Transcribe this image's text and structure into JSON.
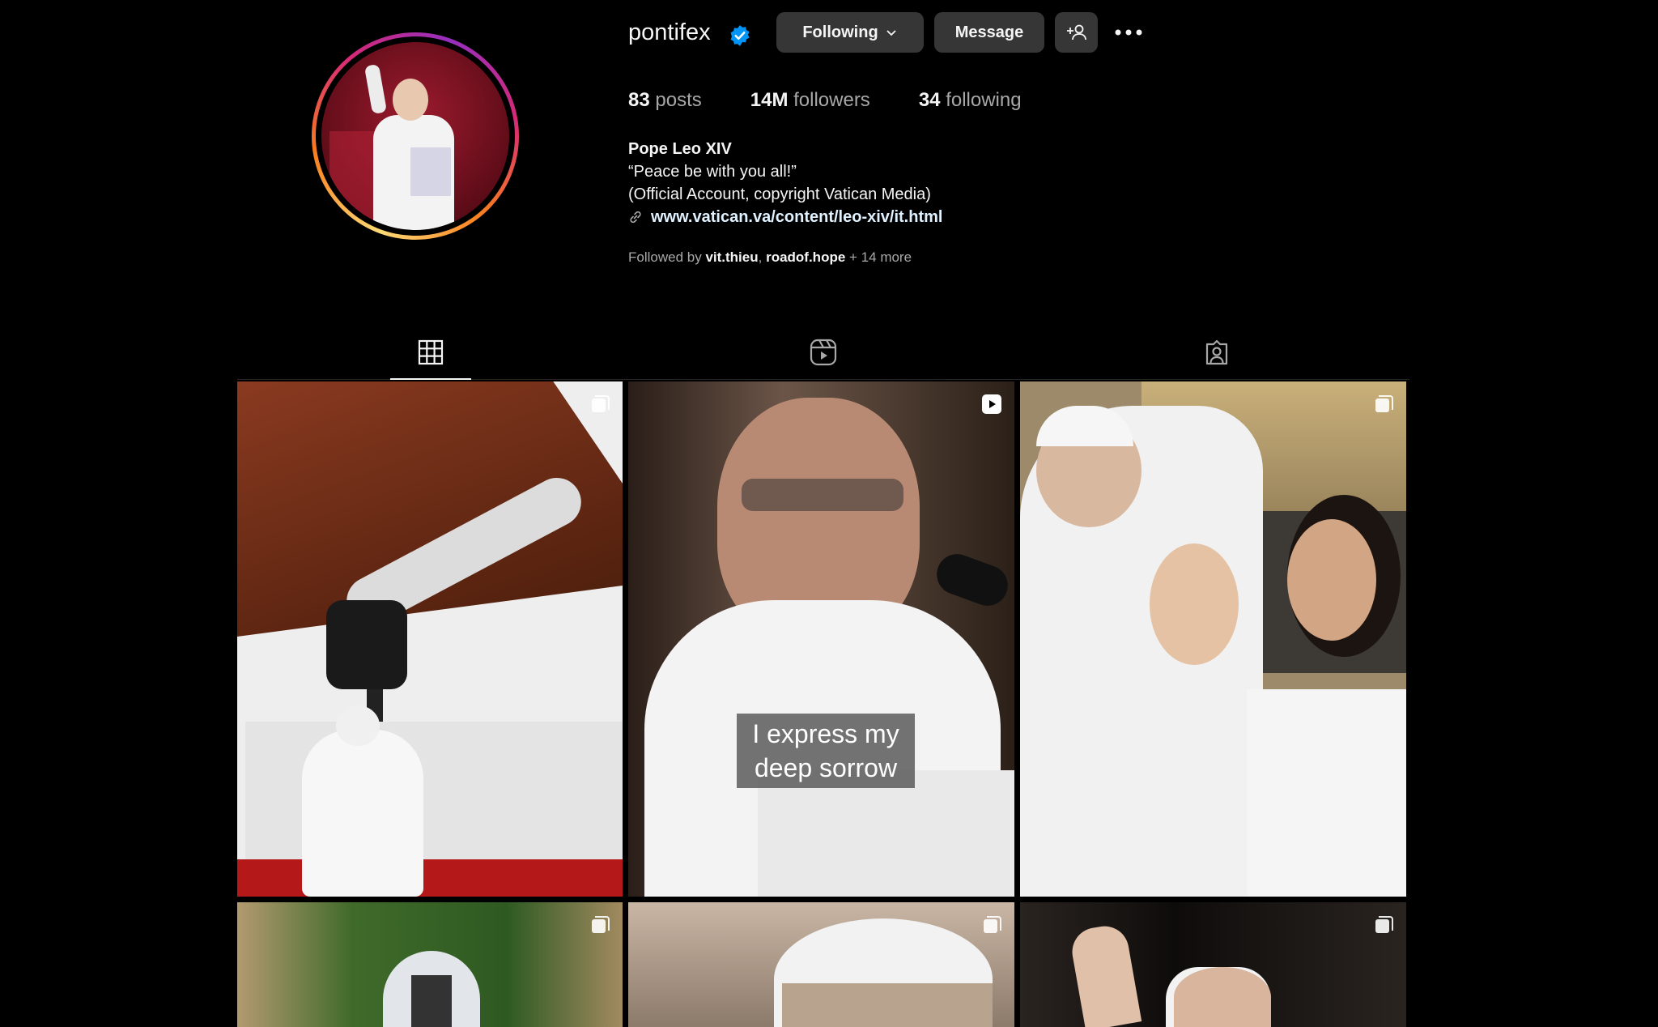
{
  "profile": {
    "username": "pontifex",
    "following_label": "Following",
    "message_label": "Message",
    "stats": {
      "posts_count": "83",
      "posts_label": "posts",
      "followers_count": "14M",
      "followers_label": "followers",
      "following_count": "34",
      "following_label": "following"
    },
    "bio": {
      "name": "Pope Leo XIV",
      "line1": "“Peace be with you all!”",
      "line2": "(Official Account, copyright Vatican Media)",
      "link": "www.vatican.va/content/leo-xiv/it.html"
    },
    "followed_by": {
      "prefix": "Followed by",
      "user1": "vit.thieu",
      "user2": "roadof.hope",
      "more": "+ 14 more"
    }
  },
  "tabs": [
    "grid-icon",
    "reels-icon",
    "tagged-icon"
  ],
  "posts": {
    "p2_caption_line1": "I express my",
    "p2_caption_line2": "deep sorrow"
  },
  "colors": {
    "background": "#000000",
    "button": "#363636",
    "verified": "#0095f6"
  }
}
